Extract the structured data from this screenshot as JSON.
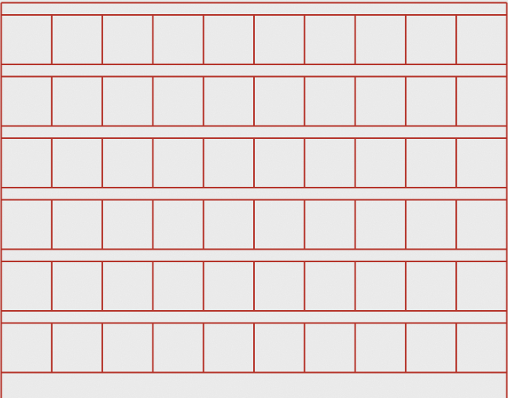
{
  "paper": {
    "background_color": "#eeeeee",
    "speckle_color": "#d8d8d8",
    "highlight_color": "#f7f7f7"
  },
  "grid": {
    "line_color": "#b5342a",
    "rows": 6,
    "columns": 10
  }
}
